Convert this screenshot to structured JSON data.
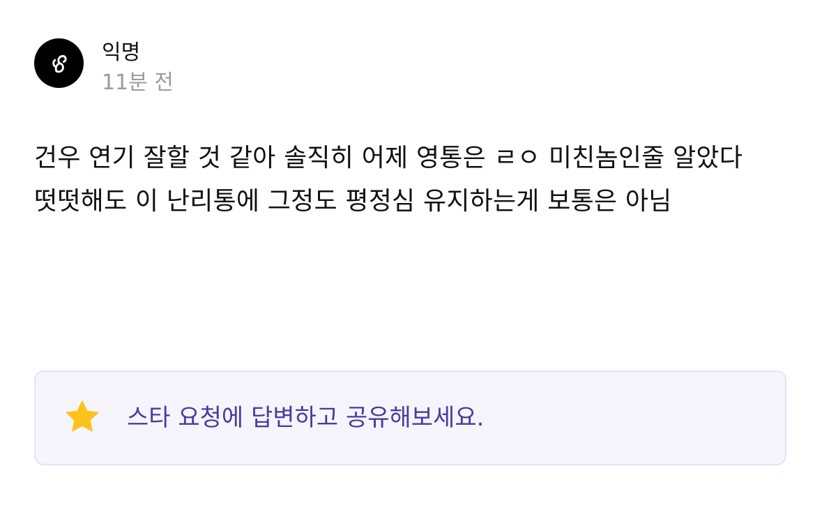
{
  "post": {
    "author": "익명",
    "time": "11분 전",
    "content": "건우 연기 잘할 것 같아 솔직히 어제 영통은 ㄹㅇ 미친놈인줄 알았다 떳떳해도 이 난리통에 그정도 평정심 유지하는게 보통은 아님"
  },
  "cta": {
    "text": "스타 요청에 답변하고 공유해보세요.",
    "icon": "star-icon"
  },
  "colors": {
    "avatar_bg": "#000000",
    "time_text": "#9a9a9a",
    "cta_bg": "#f6f4fd",
    "cta_border": "#e6e1fb",
    "cta_text": "#4b3a9f",
    "star": "#ffc21a"
  }
}
